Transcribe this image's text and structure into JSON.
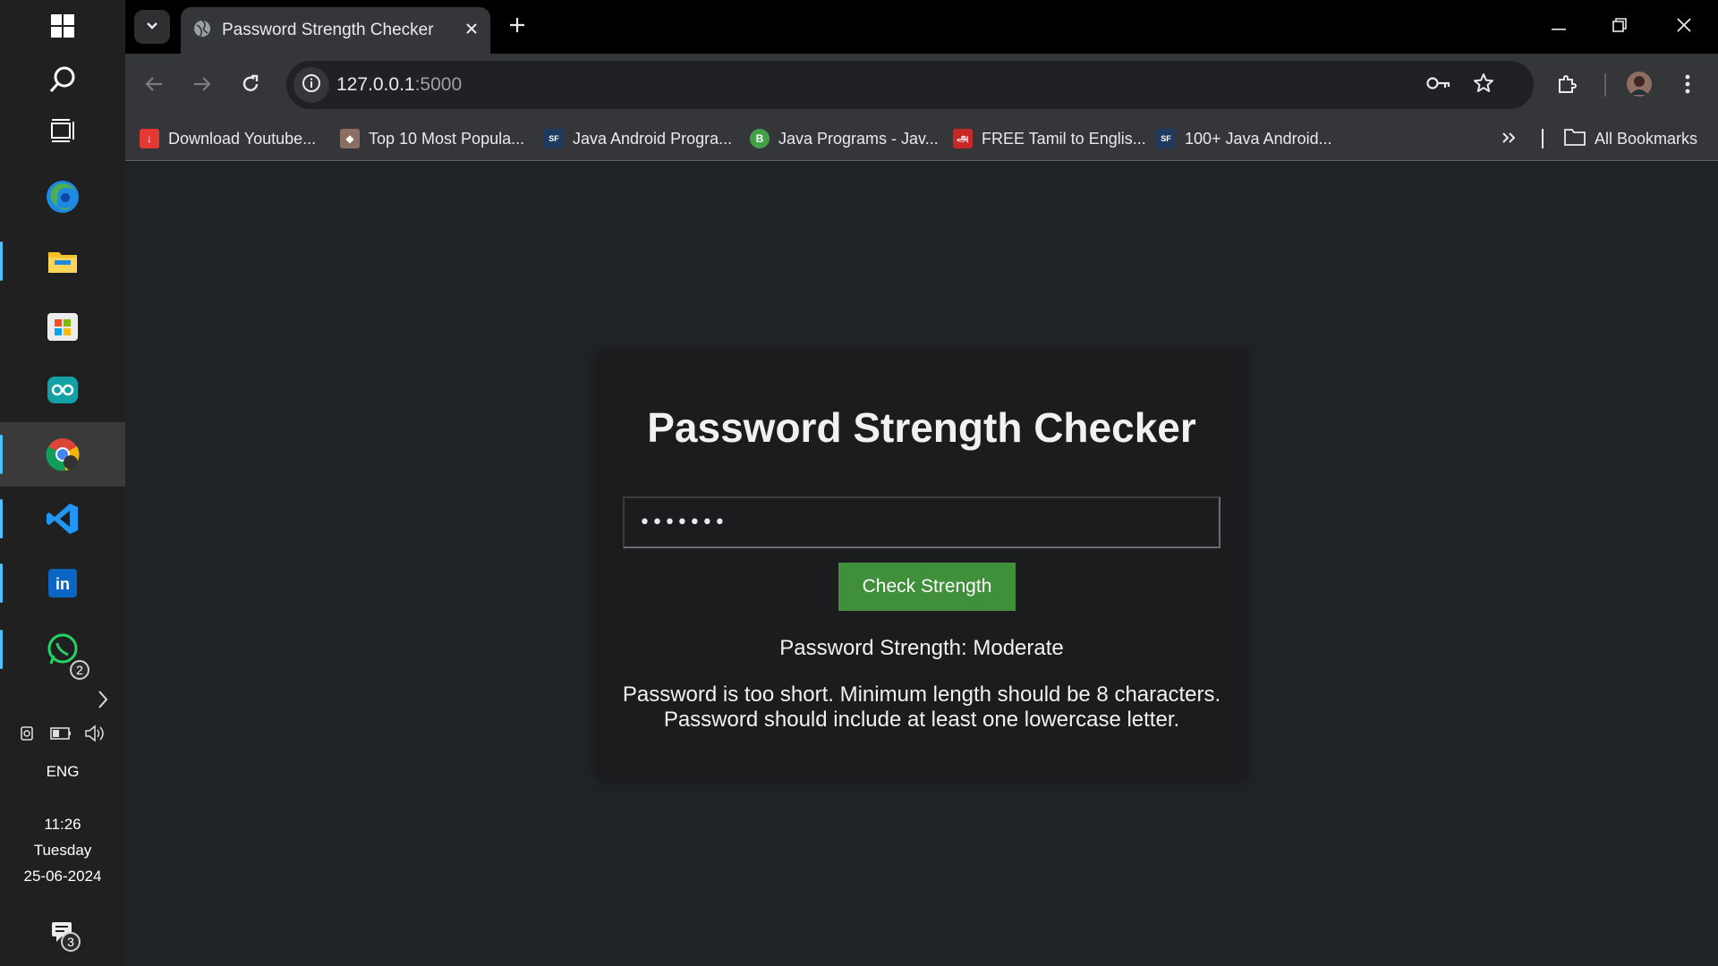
{
  "taskbar": {
    "apps": [
      {
        "name": "windows-start",
        "icon": "windows-logo-icon"
      },
      {
        "name": "search",
        "icon": "search-icon"
      },
      {
        "name": "task-view",
        "icon": "task-view-icon"
      },
      {
        "name": "edge",
        "icon": "edge-icon"
      },
      {
        "name": "file-explorer",
        "icon": "folder-icon"
      },
      {
        "name": "microsoft-store",
        "icon": "store-icon"
      },
      {
        "name": "arduino",
        "icon": "arduino-icon"
      },
      {
        "name": "chrome",
        "icon": "chrome-icon"
      },
      {
        "name": "vscode",
        "icon": "vscode-icon"
      },
      {
        "name": "linkedin",
        "icon": "linkedin-icon"
      },
      {
        "name": "whatsapp",
        "icon": "whatsapp-icon"
      }
    ],
    "whatsapp_badge": "2",
    "language": "ENG",
    "time": "11:26",
    "day": "Tuesday",
    "date": "25-06-2024",
    "notification_badge": "3"
  },
  "browser": {
    "tab_title": "Password Strength Checker",
    "url_host": "127.0.0.1",
    "url_port": ":5000",
    "bookmarks": [
      {
        "label": "Download Youtube...",
        "color": "#e53935"
      },
      {
        "label": "Top 10 Most Popula...",
        "color": "#8d6e63"
      },
      {
        "label": "Java Android Progra...",
        "color": "#1e3a5f"
      },
      {
        "label": "Java Programs - Jav...",
        "color": "#43a047"
      },
      {
        "label": "FREE Tamil to Englis...",
        "color": "#c62828"
      },
      {
        "label": "100+ Java Android...",
        "color": "#1e3a5f"
      }
    ],
    "all_bookmarks": "All Bookmarks"
  },
  "page": {
    "title": "Password Strength Checker",
    "password_value": "•••••••",
    "button_label": "Check Strength",
    "strength_text": "Password Strength: Moderate",
    "messages": [
      "Password is too short. Minimum length should be 8 characters.",
      "Password should include at least one lowercase letter."
    ],
    "accent_color": "#3f8f3b"
  }
}
